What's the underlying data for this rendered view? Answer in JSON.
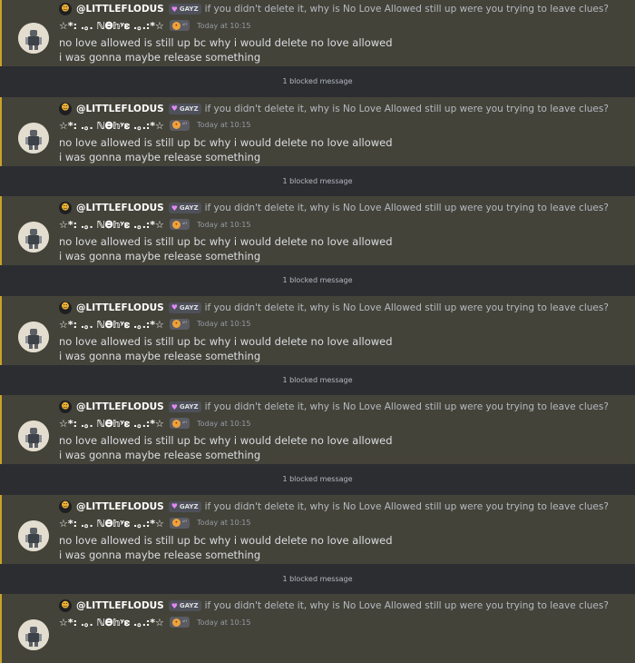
{
  "messages": [
    {
      "reply_user": "@LITTLEFLODUS",
      "reply_tag": "GAYZ",
      "reply_text": "if you didn't delete it, why is No Love Allowed still up were you trying to leave clues?",
      "username": "☆*: .｡. ℕ𝚯𝕙ʸ𝛆 .｡.:*☆",
      "badge": "ꜜꜝꜝ",
      "timestamp": "Today at 10:15",
      "lines": [
        "no love allowed is still up bc why i would delete no love allowed",
        "i was gonna maybe release something"
      ]
    },
    {
      "reply_user": "@LITTLEFLODUS",
      "reply_tag": "GAYZ",
      "reply_text": "if you didn't delete it, why is No Love Allowed still up were you trying to leave clues?",
      "username": "☆*: .｡. ℕ𝚯𝕙ʸ𝛆 .｡.:*☆",
      "badge": "ꜜꜝꜝ",
      "timestamp": "Today at 10:15",
      "lines": [
        "no love allowed is still up bc why i would delete no love allowed",
        "i was gonna maybe release something"
      ]
    },
    {
      "reply_user": "@LITTLEFLODUS",
      "reply_tag": "GAYZ",
      "reply_text": "if you didn't delete it, why is No Love Allowed still up were you trying to leave clues?",
      "username": "☆*: .｡. ℕ𝚯𝕙ʸ𝛆 .｡.:*☆",
      "badge": "ꜜꜝꜝ",
      "timestamp": "Today at 10:15",
      "lines": [
        "no love allowed is still up bc why i would delete no love allowed",
        "i was gonna maybe release something"
      ]
    },
    {
      "reply_user": "@LITTLEFLODUS",
      "reply_tag": "GAYZ",
      "reply_text": "if you didn't delete it, why is No Love Allowed still up were you trying to leave clues?",
      "username": "☆*: .｡. ℕ𝚯𝕙ʸ𝛆 .｡.:*☆",
      "badge": "ꜜꜝꜝ",
      "timestamp": "Today at 10:15",
      "lines": [
        "no love allowed is still up bc why i would delete no love allowed",
        "i was gonna maybe release something"
      ]
    },
    {
      "reply_user": "@LITTLEFLODUS",
      "reply_tag": "GAYZ",
      "reply_text": "if you didn't delete it, why is No Love Allowed still up were you trying to leave clues?",
      "username": "☆*: .｡. ℕ𝚯𝕙ʸ𝛆 .｡.:*☆",
      "badge": "ꜜꜝꜝ",
      "timestamp": "Today at 10:15",
      "lines": [
        "no love allowed is still up bc why i would delete no love allowed",
        "i was gonna maybe release something"
      ]
    },
    {
      "reply_user": "@LITTLEFLODUS",
      "reply_tag": "GAYZ",
      "reply_text": "if you didn't delete it, why is No Love Allowed still up were you trying to leave clues?",
      "username": "☆*: .｡. ℕ𝚯𝕙ʸ𝛆 .｡.:*☆",
      "badge": "ꜜꜝꜝ",
      "timestamp": "Today at 10:15",
      "lines": [
        "no love allowed is still up bc why i would delete no love allowed",
        "i was gonna maybe release something"
      ]
    },
    {
      "reply_user": "@LITTLEFLODUS",
      "reply_tag": "GAYZ",
      "reply_text": "if you didn't delete it, why is No Love Allowed still up were you trying to leave clues?",
      "username": "☆*: .｡. ℕ𝚯𝕙ʸ𝛆 .｡.:*☆",
      "badge": "ꜜꜝꜝ",
      "timestamp": "Today at 10:15",
      "lines": [
        "",
        ""
      ]
    }
  ],
  "blocked_label": "1 blocked message",
  "icons": {
    "reply_avatar": "mask-icon",
    "tag_icon": "heart-icon",
    "badge_icon": "face-icon",
    "avatar": "figure-avatar-icon"
  },
  "colors": {
    "highlight_bg": "#44433a",
    "highlight_border": "#c9a227",
    "background": "#2f3138",
    "tag_heart": "#e389f5"
  }
}
